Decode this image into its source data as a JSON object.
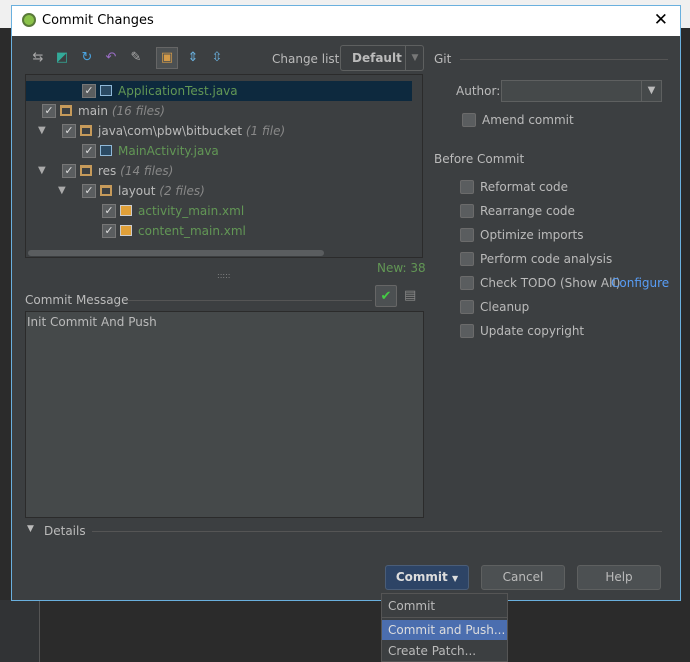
{
  "window": {
    "title": "Commit Changes",
    "close": "✕"
  },
  "toolbar": {
    "change_list_label": "Change list:",
    "change_list_value": "Default",
    "icons": [
      "show-diff-icon",
      "move-to-changelist-icon",
      "refresh-icon",
      "rollback-icon",
      "edit-source-icon",
      "group-by-directory-icon",
      "expand-all-icon",
      "collapse-all-icon"
    ]
  },
  "tree": [
    {
      "name": "ApplicationTest.java",
      "kind": "java",
      "level": 3,
      "selected": true
    },
    {
      "name": "main",
      "count": "(16 files)",
      "kind": "folder",
      "level": 1
    },
    {
      "name": "java\\com\\pbw\\bitbucket",
      "count": "(1 file)",
      "kind": "folder",
      "level": 2
    },
    {
      "name": "MainActivity.java",
      "kind": "java",
      "level": 3
    },
    {
      "name": "res",
      "count": "(14 files)",
      "kind": "folder",
      "level": 2
    },
    {
      "name": "layout",
      "count": "(2 files)",
      "kind": "folder",
      "level": 3
    },
    {
      "name": "activity_main.xml",
      "kind": "xml",
      "level": 4
    },
    {
      "name": "content_main.xml",
      "kind": "xml",
      "level": 4
    }
  ],
  "status": {
    "new": "New: 38"
  },
  "commit_message": {
    "label": "Commit Message",
    "value": "Init Commit And Push"
  },
  "git": {
    "label": "Git",
    "author_label": "Author:",
    "author_value": "",
    "amend": "Amend commit"
  },
  "before_commit": {
    "label": "Before Commit",
    "options": [
      "Reformat code",
      "Rearrange code",
      "Optimize imports",
      "Perform code analysis",
      "Check TODO (Show All)",
      "Cleanup",
      "Update copyright"
    ],
    "configure": "Configure"
  },
  "details": {
    "label": "Details"
  },
  "buttons": {
    "commit": "Commit",
    "cancel": "Cancel",
    "help": "Help"
  },
  "menu": {
    "items": [
      "Commit",
      "Commit and Push...",
      "Create Patch..."
    ],
    "highlighted": 1
  },
  "colors": {
    "accent": "#4b6eaf",
    "new_files": "#629755",
    "link": "#589df6"
  }
}
